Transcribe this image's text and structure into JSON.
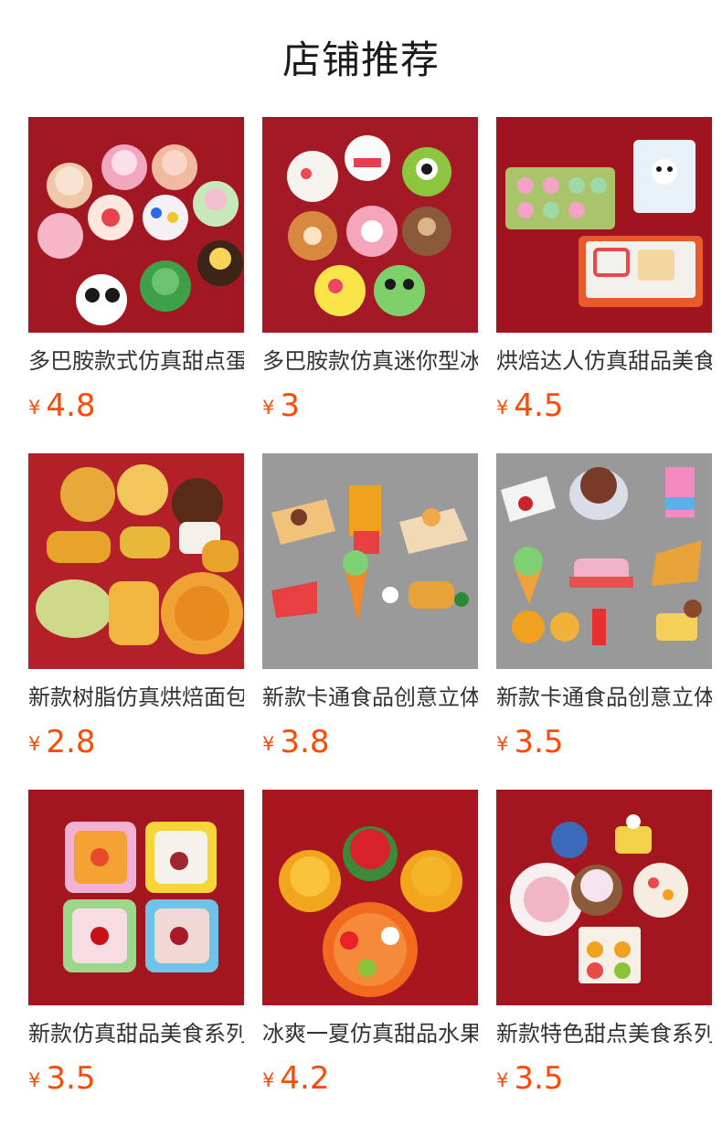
{
  "header": {
    "title": "店铺推荐"
  },
  "currency": "¥",
  "products": [
    {
      "name": "多巴胺款式仿真甜点蛋糕",
      "price": "4.8",
      "bg": "#a11722",
      "items": "cakes"
    },
    {
      "name": "多巴胺款仿真迷你型冰箱贴",
      "price": "3",
      "bg": "#a31a26",
      "items": "cartoon"
    },
    {
      "name": "烘焙达人仿真甜品美食",
      "price": "4.5",
      "bg": "#a0141f",
      "items": "baking"
    },
    {
      "name": "新款树脂仿真烘焙面包",
      "price": "2.8",
      "bg": "#b32028",
      "items": "bread"
    },
    {
      "name": "新款卡通食品创意立体冰箱贴",
      "price": "3.8",
      "bg": "#9a9a9a",
      "items": "gray1"
    },
    {
      "name": "新款卡通食品创意立体冰箱贴",
      "price": "3.5",
      "bg": "#999999",
      "items": "gray2"
    },
    {
      "name": "新款仿真甜品美食系列",
      "price": "3.5",
      "bg": "#a3151f",
      "items": "bowls"
    },
    {
      "name": "冰爽一夏仿真甜品水果",
      "price": "4.2",
      "bg": "#a8161f",
      "items": "fruit"
    },
    {
      "name": "新款特色甜点美食系列",
      "price": "3.5",
      "bg": "#a4161f",
      "items": "dessert"
    }
  ]
}
